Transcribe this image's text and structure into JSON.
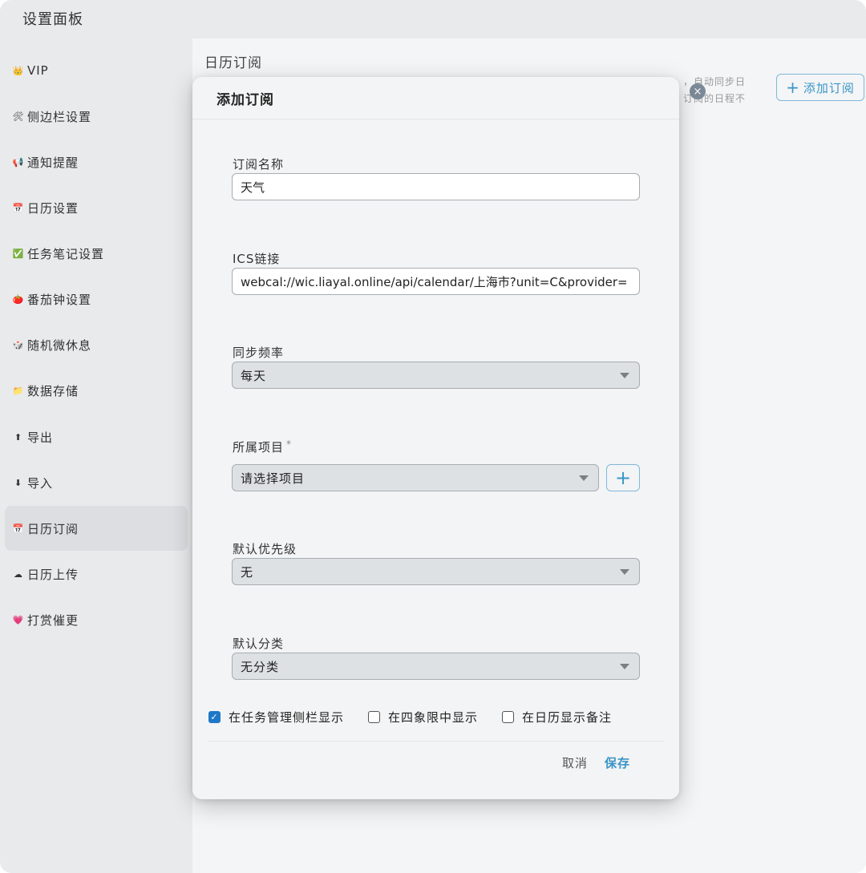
{
  "window": {
    "title": "设置面板"
  },
  "sidebar": {
    "items": [
      {
        "icon": "👑",
        "label": "VIP"
      },
      {
        "icon": "🛠",
        "label": "侧边栏设置"
      },
      {
        "icon": "📢",
        "label": "通知提醒"
      },
      {
        "icon": "📅",
        "label": "日历设置"
      },
      {
        "icon": "✅",
        "label": "任务笔记设置"
      },
      {
        "icon": "🍅",
        "label": "番茄钟设置"
      },
      {
        "icon": "🎲",
        "label": "随机微休息"
      },
      {
        "icon": "📁",
        "label": "数据存储"
      },
      {
        "icon": "⬆",
        "label": "导出"
      },
      {
        "icon": "⬇",
        "label": "导入"
      },
      {
        "icon": "📅",
        "label": "日历订阅"
      },
      {
        "icon": "☁",
        "label": "日历上传"
      },
      {
        "icon": "💗",
        "label": "打赏催更"
      }
    ],
    "active_index": 10
  },
  "main": {
    "title": "日历订阅",
    "behind_text_line1": "，自动同步日",
    "behind_text_line2": "订阅的日程不",
    "add_subscription_label": "添加订阅",
    "add_subscription_plus": "+"
  },
  "dialog": {
    "title": "添加订阅",
    "name_label": "订阅名称",
    "name_value": "天气",
    "ics_label": "ICS链接",
    "ics_value": "webcal://wic.liayal.online/api/calendar/上海市?unit=C&provider=",
    "sync_label": "同步频率",
    "sync_value": "每天",
    "project_label": "所属项目",
    "project_required": "*",
    "project_placeholder": "请选择项目",
    "add_project_plus": "+",
    "priority_label": "默认优先级",
    "priority_value": "无",
    "category_label": "默认分类",
    "category_value": "无分类",
    "checkboxes": [
      {
        "label": "在任务管理侧栏显示",
        "checked": true
      },
      {
        "label": "在四象限中显示",
        "checked": false
      },
      {
        "label": "在日历显示备注",
        "checked": false
      }
    ],
    "cancel_label": "取消",
    "save_label": "保存"
  }
}
